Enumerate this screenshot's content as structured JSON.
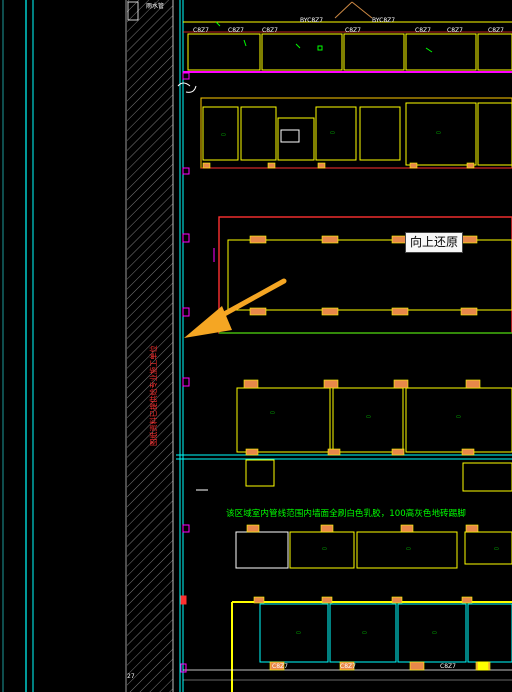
{
  "drawing": {
    "top_labels": [
      "C8Z7",
      "C8Z7",
      "C8Z7",
      "BYC8Z7",
      "C8Z7",
      "BYC8Z7",
      "C8Z7",
      "C8Z7",
      "C8Z7"
    ],
    "corner_label": "雨水管",
    "note_green": "该区域室内管线范围内墙面全刷白色乳胶，100高灰色地砖踢脚",
    "note_red_vertical": "图纸资料已提供给专业施工单位",
    "bottom_labels": [
      "C8Z7",
      "C8Z7",
      "C8Z7"
    ],
    "left_edge_label": "27"
  },
  "tooltip": {
    "text": "向上还原"
  },
  "colors": {
    "background": "#000000",
    "wall_yellow": "#ffff00",
    "axis_cyan": "#00ffff",
    "door_magenta": "#ff00ff",
    "wall_red": "#ff3030",
    "text_green": "#00ff00",
    "column_orange": "#e8884a",
    "hatch": "#8a8a8a",
    "arrow": "#f5a623"
  }
}
